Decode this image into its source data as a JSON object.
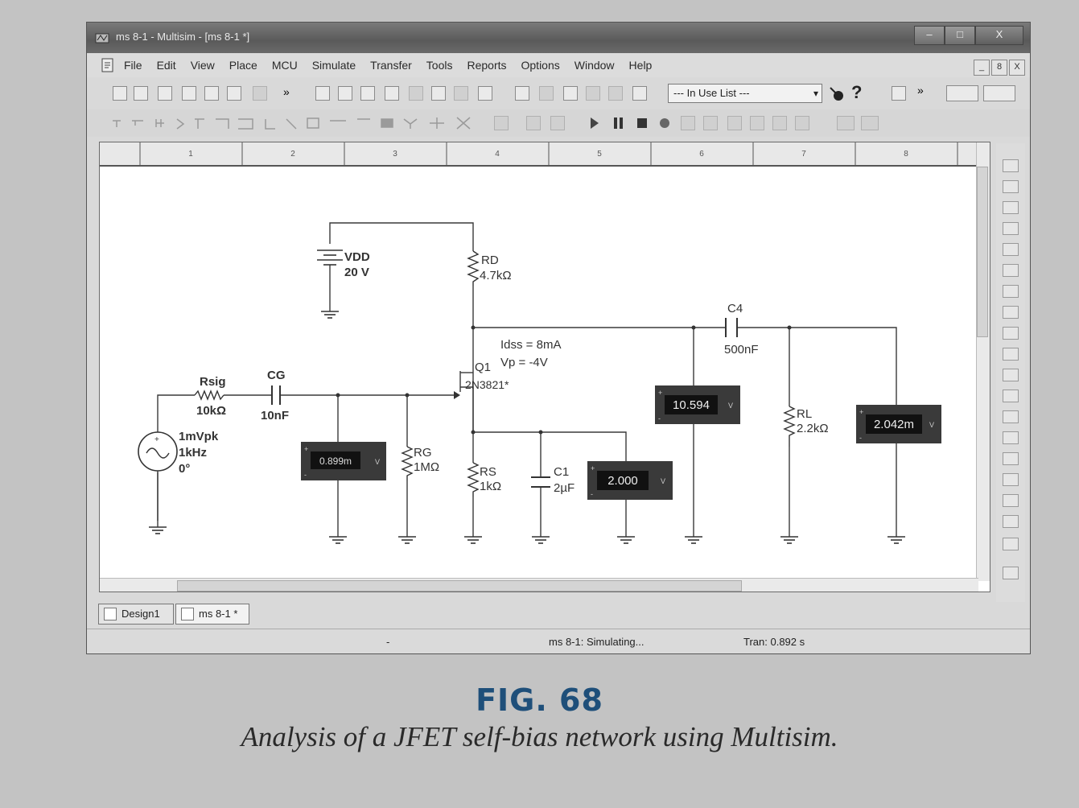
{
  "window": {
    "title": "ms 8-1 - Multisim - [ms 8-1 *]",
    "btn_min": "–",
    "btn_max": "□",
    "btn_close": "X"
  },
  "menu": [
    "File",
    "Edit",
    "View",
    "Place",
    "MCU",
    "Simulate",
    "Transfer",
    "Tools",
    "Reports",
    "Options",
    "Window",
    "Help"
  ],
  "mdi_controls": [
    "_",
    "8",
    "X"
  ],
  "toolbar": {
    "more": "»",
    "more2": "»",
    "in_use_list": "--- In Use List ---",
    "help": "?"
  },
  "ruler": [
    "1",
    "2",
    "3",
    "4",
    "5",
    "6",
    "7",
    "8"
  ],
  "schematic": {
    "vdd_name": "VDD",
    "vdd_value": "20 V",
    "rd_name": "RD",
    "rd_value": "4.7kΩ",
    "c4_name": "C4",
    "c4_value": "500nF",
    "jfet_idss": "Idss = 8mA",
    "jfet_vp": "Vp = -4V",
    "q1_name": "Q1",
    "q1_part": "2N3821*",
    "rsig_name": "Rsig",
    "rsig_value": "10kΩ",
    "cg_name": "CG",
    "cg_value": "10nF",
    "source_amp": "1mVpk",
    "source_freq": "1kHz",
    "source_phase": "0°",
    "rg_name": "RG",
    "rg_value": "1MΩ",
    "rs_name": "RS",
    "rs_value": "1kΩ",
    "c1_name": "C1",
    "c1_value": "2µF",
    "rl_name": "RL",
    "rl_value": "2.2kΩ",
    "meter_gate": "0.899m",
    "meter_source": "2.000",
    "meter_drain": "10.594",
    "meter_load": "2.042m",
    "meter_plus": "+",
    "meter_minus": "-",
    "meter_unit": "V"
  },
  "tabs": [
    "Design1",
    "ms 8-1 *"
  ],
  "status": {
    "dash": "-",
    "simulating": "ms 8-1: Simulating...",
    "tran": "Tran: 0.892 s"
  },
  "figure": {
    "label": "FIG. 68",
    "caption": "Analysis of a JFET self-bias network using Multisim."
  }
}
